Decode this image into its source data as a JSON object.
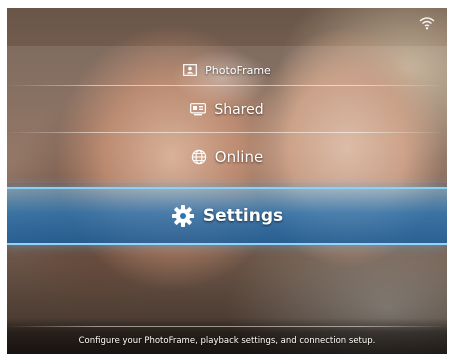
{
  "menu": {
    "items": [
      {
        "label": "PhotoFrame",
        "icon": "photoframe-icon"
      },
      {
        "label": "Shared",
        "icon": "shared-icon"
      },
      {
        "label": "Online",
        "icon": "globe-icon"
      },
      {
        "label": "Settings",
        "icon": "gear-icon",
        "selected": true
      }
    ]
  },
  "status": {
    "text": "Configure your PhotoFrame, playback settings, and connection setup."
  },
  "indicators": {
    "wifi": "wifi-icon"
  },
  "colors": {
    "highlight": "#2a7fc0",
    "text": "#ffffff"
  }
}
